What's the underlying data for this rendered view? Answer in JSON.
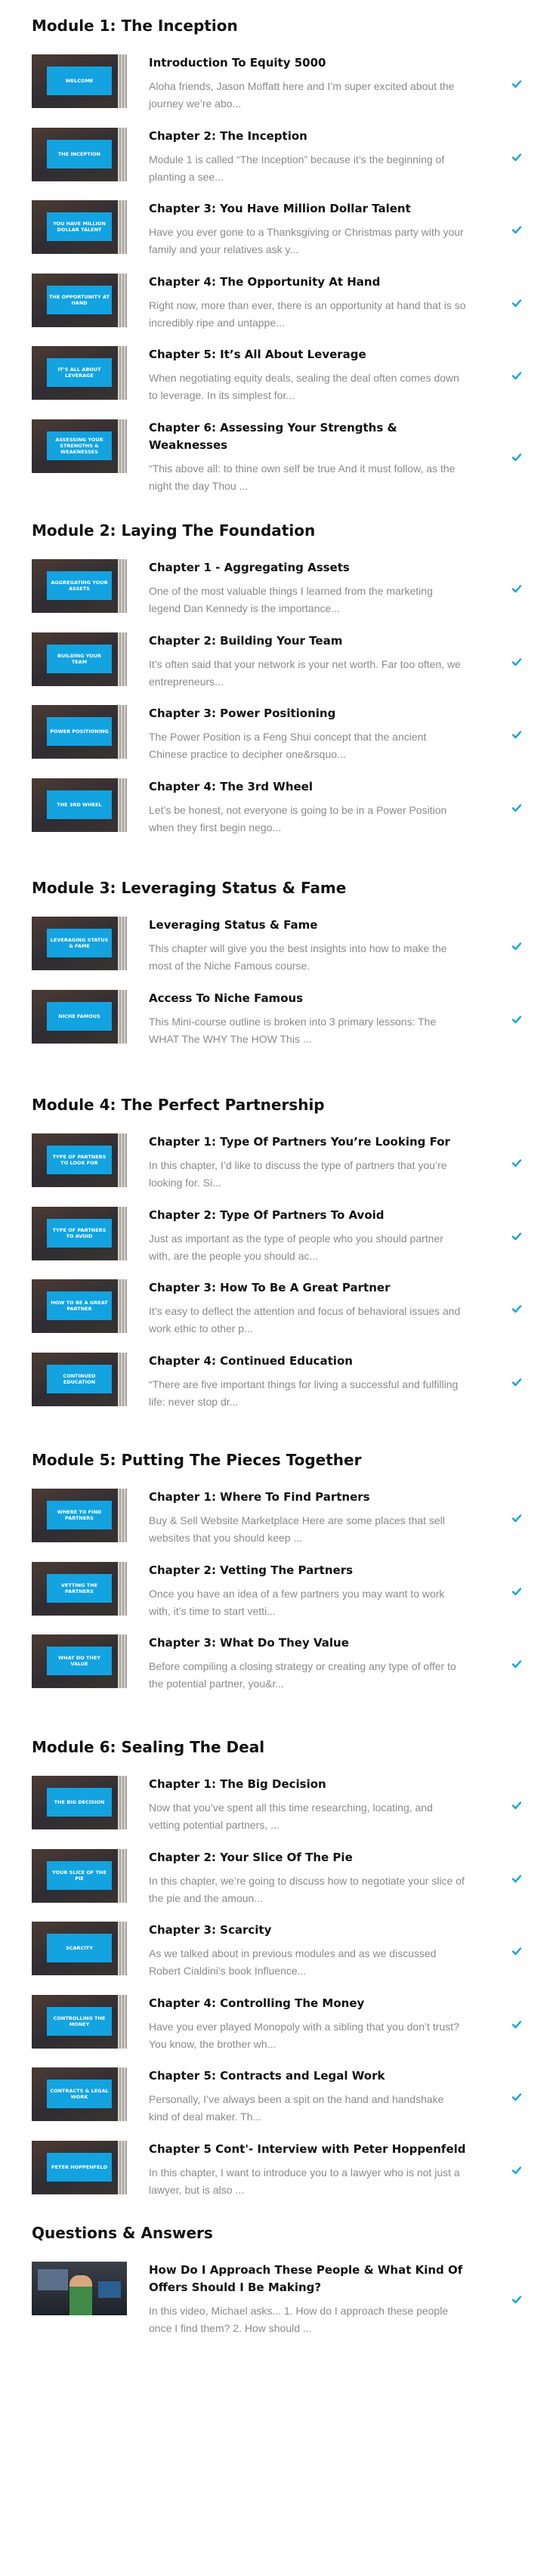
{
  "colors": {
    "accent": "#12a3e0",
    "heading": "#111111",
    "muted": "#8a8a8a"
  },
  "status_icon": "check-icon",
  "modules": [
    {
      "title": "Module 1: The Inception",
      "lessons": [
        {
          "title": "Introduction To Equity 5000",
          "description": "Aloha friends, Jason Moffatt here and I’m super excited about the journey we’re abo...",
          "thumb": "Welcome",
          "completed": true
        },
        {
          "title": "Chapter 2: The Inception",
          "description": "Module 1 is called “The Inception” because it’s the beginning of planting a see...",
          "thumb": "The Inception",
          "completed": true
        },
        {
          "title": "Chapter 3: You Have Million Dollar Talent",
          "description": "Have you ever gone to a Thanksgiving or Christmas party with your family and your relatives ask y...",
          "thumb": "You Have Million Dollar Talent",
          "completed": true
        },
        {
          "title": "Chapter 4: The Opportunity At Hand",
          "description": "Right now, more than ever, there is an opportunity at hand that is so incredibly ripe and untappe...",
          "thumb": "The Opportunity At Hand",
          "completed": true
        },
        {
          "title": "Chapter 5: It’s All About Leverage",
          "description": "When negotiating equity deals, sealing the deal often comes down to leverage. In its simplest for...",
          "thumb": "It’s All About Leverage",
          "completed": true
        },
        {
          "title": "Chapter 6: Assessing Your Strengths & Weaknesses",
          "description": "“This above all: to thine own self be true And it must follow, as the night the day Thou ...",
          "thumb": "Assessing Your Strengths & Weaknesses",
          "completed": true
        }
      ]
    },
    {
      "title": "Module 2: Laying The Foundation",
      "lessons": [
        {
          "title": "Chapter 1 - Aggregating Assets",
          "description": "One of the most valuable things I learned from the marketing legend Dan Kennedy is the importance...",
          "thumb": "Aggregating Your Assets",
          "completed": true
        },
        {
          "title": "Chapter 2: Building Your Team",
          "description": "It’s often said that your network is your net worth.  Far too often, we entrepreneurs...",
          "thumb": "Building Your Team",
          "completed": true
        },
        {
          "title": "Chapter 3: Power Positioning",
          "description": "The Power Position is a Feng Shui concept that the ancient Chinese practice to decipher one&rsquo...",
          "thumb": "Power Positioning",
          "completed": true
        },
        {
          "title": "Chapter 4: The 3rd Wheel",
          "description": "Let’s be honest, not everyone is going to be in a Power Position when they first begin nego...",
          "thumb": "The 3rd Wheel",
          "completed": true
        }
      ]
    },
    {
      "title": "Module 3: Leveraging Status & Fame",
      "lessons": [
        {
          "title": "Leveraging Status & Fame",
          "description": "This chapter will give you the best insights into how to make the most of the Niche Famous course.",
          "thumb": "Leveraging Status & Fame",
          "completed": true
        },
        {
          "title": "Access To Niche Famous",
          "description": "This Mini-course outline is broken into 3 primary lessons: The WHAT The WHY The HOW This ...",
          "thumb": "Niche Famous",
          "completed": true
        }
      ]
    },
    {
      "title": "Module 4: The Perfect Partnership",
      "lessons": [
        {
          "title": "Chapter 1: Type Of Partners You’re Looking For",
          "description": "In this chapter, I’d like to discuss the type of partners that you’re looking for. Si...",
          "thumb": "Type Of Partners To Look For",
          "completed": true
        },
        {
          "title": "Chapter 2: Type Of Partners To Avoid",
          "description": "Just as important as the type of people who you should partner with, are the people you should ac...",
          "thumb": "Type Of Partners To Avoid",
          "completed": true
        },
        {
          "title": "Chapter 3: How To Be A Great Partner",
          "description": "It’s easy to deflect the attention and focus of behavioral issues and work ethic to other p...",
          "thumb": "How To Be A Great Partner",
          "completed": true
        },
        {
          "title": "Chapter 4: Continued Education",
          "description": "“There are five important things for living a successful and fulfilling life: never stop dr...",
          "thumb": "Continued Education",
          "completed": true
        }
      ]
    },
    {
      "title": "Module 5: Putting The Pieces Together",
      "lessons": [
        {
          "title": "Chapter 1: Where To Find Partners",
          "description": "Buy & Sell Website Marketplace Here are some places that sell websites that you should keep ...",
          "thumb": "Where To Find Partners",
          "completed": true
        },
        {
          "title": "Chapter 2: Vetting The Partners",
          "description": "Once you have an idea of a few partners you may want to work with, it’s time to start vetti...",
          "thumb": "Vetting The Partners",
          "completed": true
        },
        {
          "title": "Chapter 3: What Do They Value",
          "description": "Before compiling a closing strategy or creating any type of offer to the potential partner, you&r...",
          "thumb": "What Do They Value",
          "completed": true
        }
      ]
    },
    {
      "title": "Module 6: Sealing The Deal",
      "lessons": [
        {
          "title": "Chapter 1: The Big Decision",
          "description": "Now that you’ve spent all this time researching, locating, and vetting potential partners, ...",
          "thumb": "The Big Decision",
          "completed": true
        },
        {
          "title": "Chapter 2: Your Slice Of The Pie",
          "description": "In this chapter, we’re going to discuss how to negotiate your slice of the pie and the amoun...",
          "thumb": "Your Slice Of The Pie",
          "completed": true
        },
        {
          "title": "Chapter 3: Scarcity",
          "description": "As we talked about in previous modules and as we discussed Robert Cialdini’s book Influence...",
          "thumb": "Scarcity",
          "completed": true
        },
        {
          "title": "Chapter 4: Controlling The Money",
          "description": "Have you ever played Monopoly with a sibling that you don’t trust? You know, the brother wh...",
          "thumb": "Controlling The Money",
          "completed": true
        },
        {
          "title": "Chapter 5: Contracts and Legal Work",
          "description": "Personally, I’ve always been a spit on the hand and handshake kind of deal maker.  Th...",
          "thumb": "Contracts & Legal Work",
          "completed": true
        },
        {
          "title": "Chapter 5 Cont'- Interview with Peter Hoppenfeld",
          "description": "In this chapter, I want to introduce you to a lawyer who is not just a lawyer, but is also ...",
          "thumb": "Peter Hoppenfeld",
          "completed": true
        }
      ]
    },
    {
      "title": "Questions & Answers",
      "lessons": [
        {
          "title": "How Do I Approach These People & What Kind Of Offers Should I Be Making?",
          "description": "In this video, Michael asks... 1. How do I approach these people once I find them? 2. How should ...",
          "thumb": "",
          "video": true,
          "completed": true
        }
      ]
    }
  ]
}
